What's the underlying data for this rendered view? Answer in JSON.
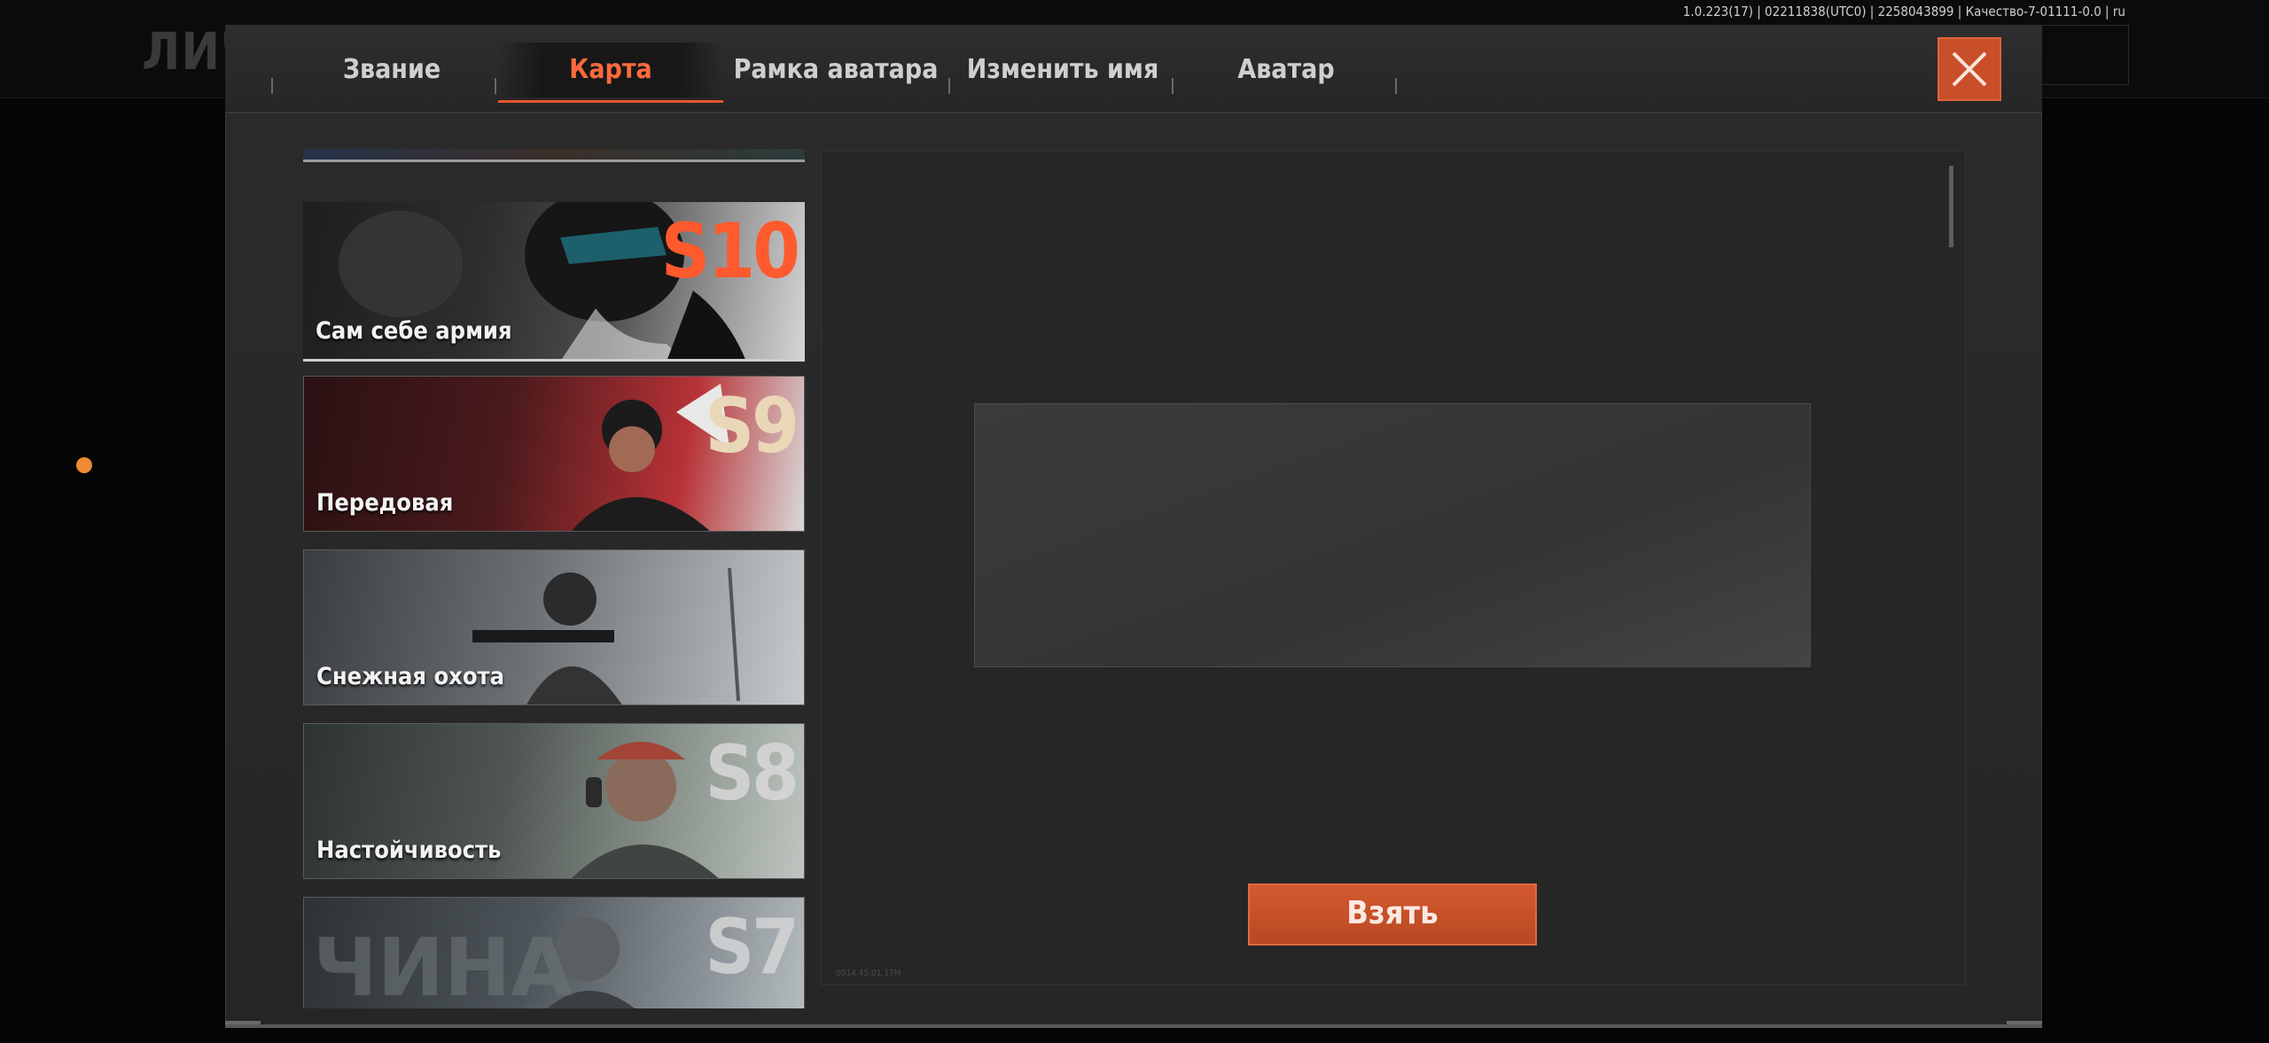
{
  "background": {
    "title": "ЛИЧН",
    "dot_color": "#ee8a2f"
  },
  "version_info": "1.0.223(17) | 02211838(UTC0) | 2258043899 | Качество-7-01111-0.0 | ru",
  "tabs": [
    {
      "label": "Звание",
      "active": false
    },
    {
      "label": "Карта",
      "active": true
    },
    {
      "label": "Рамка аватара",
      "active": false
    },
    {
      "label": "Изменить имя",
      "active": false
    },
    {
      "label": "Аватар",
      "active": false
    }
  ],
  "accent_color": "#e5572c",
  "cards": [
    {
      "label": "Сам себе армия",
      "season": "S10",
      "selected": true
    },
    {
      "label": "Передовая",
      "season": "S9",
      "selected": false
    },
    {
      "label": "Снежная охота",
      "season": "",
      "selected": false
    },
    {
      "label": "Настойчивость",
      "season": "S8",
      "selected": false
    },
    {
      "label": "",
      "season": "S7",
      "selected": false
    }
  ],
  "detail": {
    "take_label": "Взять",
    "note": "0014.45.01.1TM"
  }
}
